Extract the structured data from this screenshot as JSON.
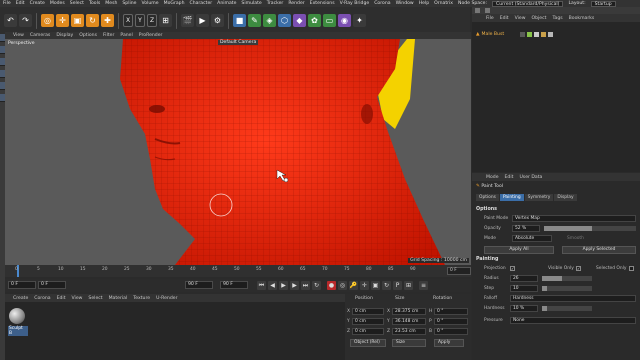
{
  "menubar": {
    "items": [
      "File",
      "Edit",
      "Create",
      "Modes",
      "Select",
      "Tools",
      "Mesh",
      "Spline",
      "Volume",
      "MoGraph",
      "Character",
      "Animate",
      "Simulate",
      "Tracker",
      "Render",
      "Extensions",
      "V-Ray Bridge",
      "Corona",
      "Window",
      "Help",
      "Ornatrix",
      "Node Space:"
    ],
    "node_space": "Current (Standard/Physical)",
    "layout_label": "Layout:",
    "layout_value": "Startup"
  },
  "toolbar": {
    "coord_x": "X",
    "coord_y": "Y",
    "coord_z": "Z"
  },
  "viewport": {
    "menu": [
      "View",
      "Cameras",
      "Display",
      "Options",
      "Filter",
      "Panel",
      "ProRender"
    ],
    "label": "Perspective",
    "camera": "Default Camera",
    "grid_spacing": "Grid Spacing : 10000 cm",
    "colors": {
      "mesh": "#e8200f",
      "vertex_map": "#f4d200",
      "background": "#5a5a5a"
    }
  },
  "timeline": {
    "ticks": [
      "0",
      "5",
      "10",
      "15",
      "20",
      "25",
      "30",
      "35",
      "40",
      "45",
      "50",
      "55",
      "60",
      "65",
      "70",
      "75",
      "80",
      "85",
      "90"
    ],
    "current_frame": "0 F"
  },
  "transport": {
    "start": "0 F",
    "current": "0 F",
    "end": "90 F",
    "end2": "90 F"
  },
  "material_manager": {
    "menu": [
      "Create",
      "Corona",
      "Edit",
      "View",
      "Select",
      "Material",
      "Texture",
      "U-Render"
    ],
    "material_name": "Sculpt B"
  },
  "coordinates": {
    "headers": [
      "Position",
      "Size",
      "Rotation"
    ],
    "rows": [
      {
        "axis": "X",
        "pos": "0 cm",
        "size": "28.375 cm",
        "rot_axis": "H",
        "rot": "0 °"
      },
      {
        "axis": "Y",
        "pos": "0 cm",
        "size": "36.148 cm",
        "rot_axis": "P",
        "rot": "0 °"
      },
      {
        "axis": "Z",
        "pos": "0 cm",
        "size": "23.53 cm",
        "rot_axis": "B",
        "rot": "0 °"
      }
    ],
    "mode_select": "Object (Rel)",
    "size_select": "Size",
    "apply_label": "Apply"
  },
  "object_manager": {
    "menu": [
      "File",
      "Edit",
      "View",
      "Object",
      "Tags",
      "Bookmarks"
    ],
    "object_name": "Male Bust"
  },
  "attribute_manager": {
    "menu": [
      "Mode",
      "Edit",
      "User Data"
    ],
    "tool_name": "Paint Tool",
    "tabs": [
      "Options",
      "Painting",
      "Symmetry",
      "Display"
    ],
    "active_tab": "Painting",
    "options_title": "Options",
    "paint_mode_label": "Paint Mode",
    "paint_mode_value": "Vertex Map",
    "opacity_label": "Opacity",
    "opacity_value": "52 %",
    "opacity_fraction": 0.52,
    "mode_label": "Mode",
    "mode_value": "Absolute",
    "smooth_label": "Smooth",
    "apply_all": "Apply All",
    "apply_selected": "Apply Selected",
    "painting_title": "Painting",
    "projection_label": "Projection",
    "visible_only_label": "Visible Only",
    "selected_only_label": "Selected Only",
    "radius_label": "Radius",
    "radius_value": "26",
    "step_label": "Step",
    "step_value": "10",
    "falloff_label": "Falloff",
    "falloff_value": "Hardness",
    "hardness_label": "Hardness",
    "hardness_value": "10 %",
    "pressure_label": "Pressure",
    "pressure_value": "None"
  }
}
